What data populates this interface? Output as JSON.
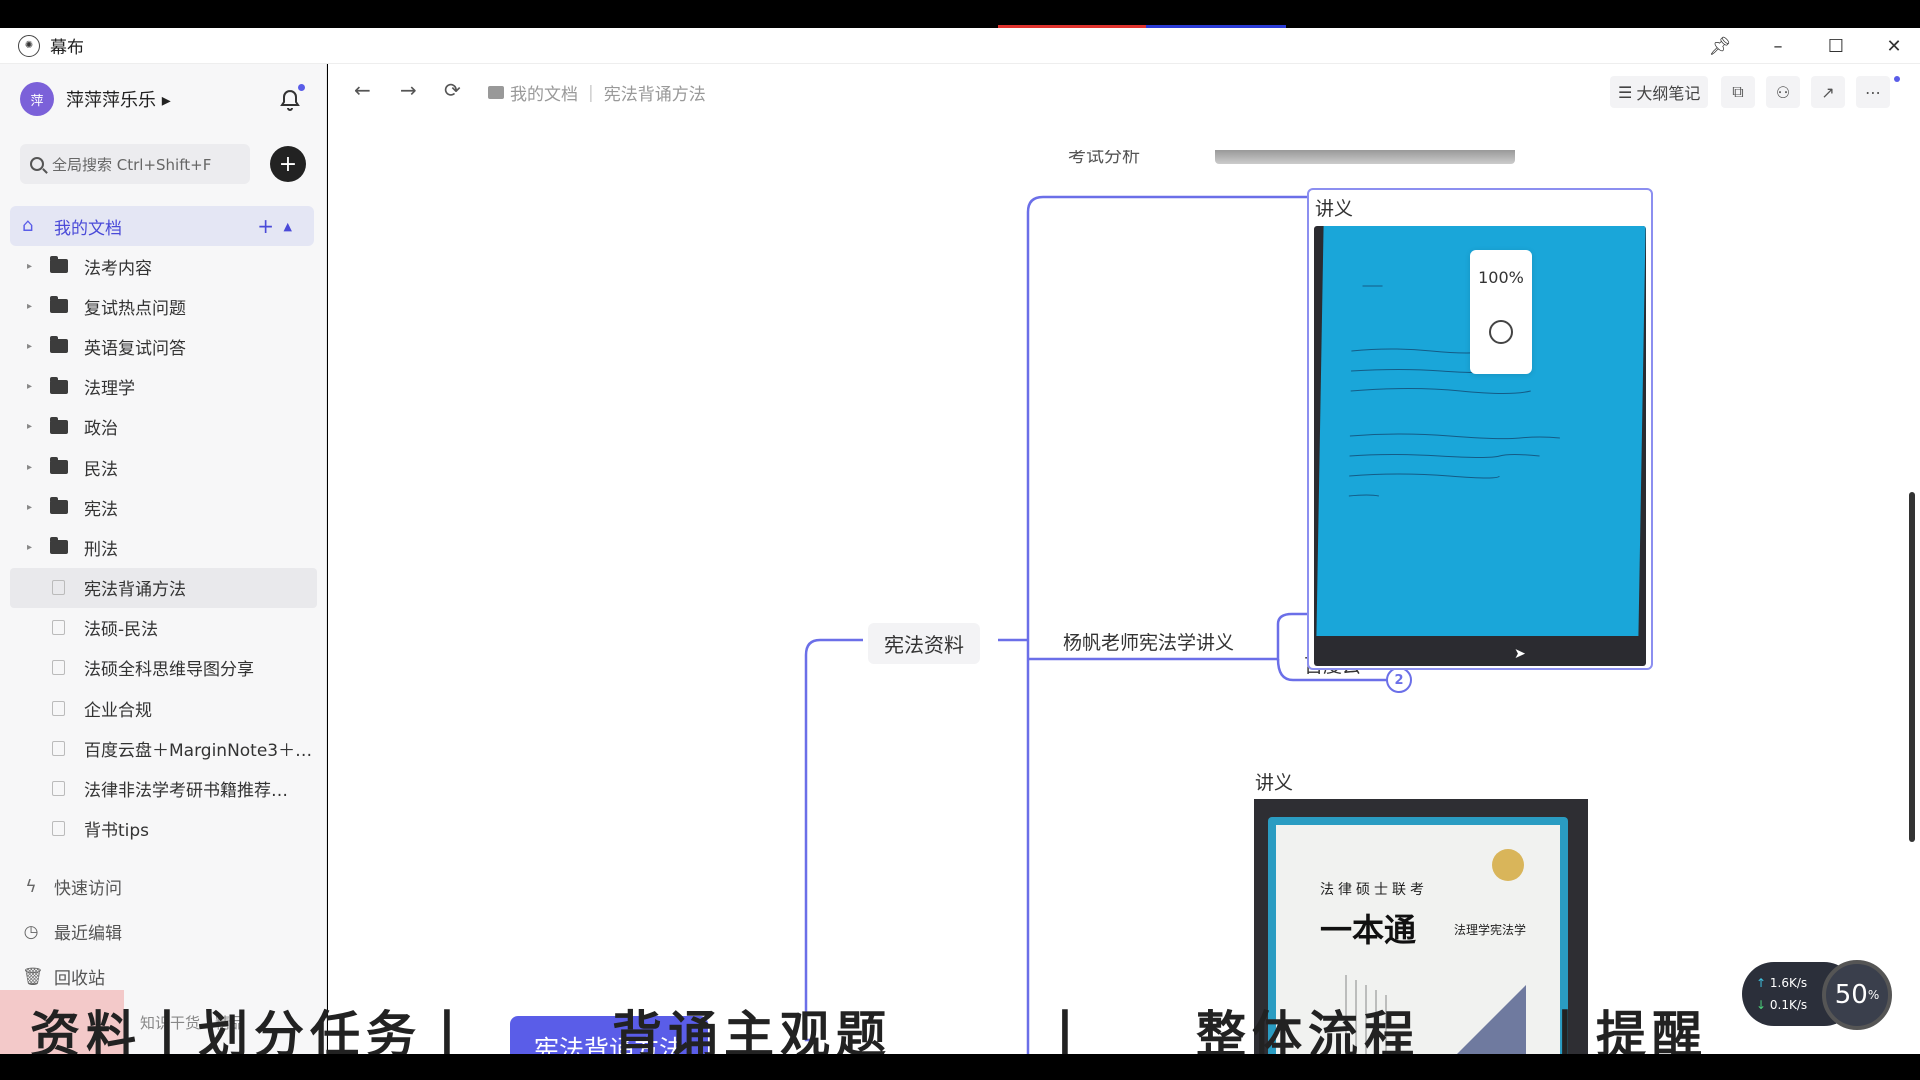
{
  "app": {
    "title": "幕布"
  },
  "window_controls": [
    "pin",
    "minimize",
    "maximize",
    "close"
  ],
  "sidebar": {
    "user": {
      "avatar_text": "萍",
      "name": "萍萍萍乐乐 ▸"
    },
    "search_placeholder": "全局搜索 Ctrl+Shift+F",
    "my_docs_label": "我的文档",
    "tree": [
      {
        "type": "folder",
        "label": "法考内容"
      },
      {
        "type": "folder",
        "label": "复试热点问题"
      },
      {
        "type": "folder",
        "label": "英语复试问答"
      },
      {
        "type": "folder",
        "label": "法理学"
      },
      {
        "type": "folder",
        "label": "政治"
      },
      {
        "type": "folder",
        "label": "民法"
      },
      {
        "type": "folder",
        "label": "宪法"
      },
      {
        "type": "folder",
        "label": "刑法"
      },
      {
        "type": "doc",
        "label": "宪法背诵方法",
        "active": true
      },
      {
        "type": "doc",
        "label": "法硕-民法"
      },
      {
        "type": "doc",
        "label": "法硕全科思维导图分享"
      },
      {
        "type": "doc",
        "label": "企业合规"
      },
      {
        "type": "doc",
        "label": "百度云盘＋MarginNote3＋…"
      },
      {
        "type": "doc",
        "label": "法律非法学考研书籍推荐…"
      },
      {
        "type": "doc",
        "label": "背书tips"
      }
    ],
    "bottom_nav": [
      {
        "icon": "lightning-icon",
        "label": "快速访问"
      },
      {
        "icon": "clock-icon",
        "label": "最近编辑"
      },
      {
        "icon": "trash-icon",
        "label": "回收站"
      }
    ],
    "footer_text": "知识干货…精品"
  },
  "toolbar": {
    "breadcrumb_root": "我的文档",
    "breadcrumb_current": "宪法背诵方法",
    "outline_button": "大纲笔记"
  },
  "canvas": {
    "zoom": "100%",
    "root_node": "宪法背诵方法",
    "branch_node": "宪法资料",
    "sub_node": "杨帆老师宪法学讲义",
    "leaf_node": "百度云",
    "badge_count": "2",
    "image1_label": "讲义",
    "image2_label": "讲义",
    "book_title_line1": "法律硕士联考",
    "book_title_main": "一本通",
    "book_subtitle": "法理学宪法学",
    "partial_top_text": "考试分析"
  },
  "network_widget": {
    "up": "1.6K/s",
    "down": "0.1K/s",
    "percent": "50",
    "unit": "%"
  },
  "video_captions": [
    "资料丨划分任务丨",
    "背诵主观题",
    "丨",
    "整体流程",
    "丨提醒"
  ],
  "colors": {
    "accent": "#5a5de8",
    "root_node_bg": "#5a5de8",
    "cover_blue": "#1aa6d9"
  }
}
